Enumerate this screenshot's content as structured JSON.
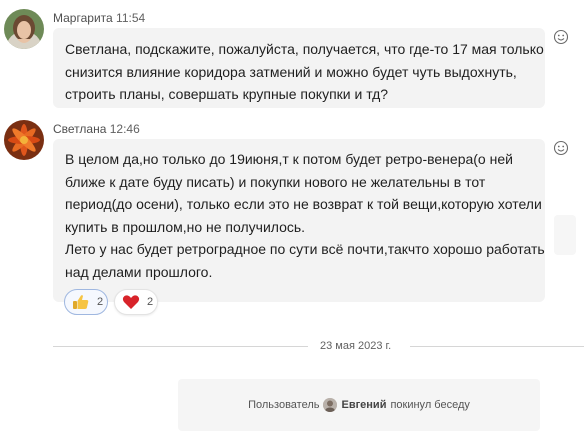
{
  "messages": [
    {
      "author": "Маргарита",
      "time": "11:54",
      "lines": [
        "Светлана, подскажите, пожалуйста, получается, что где-то 17 мая только",
        "снизится влияние коридора затмений и можно будет чуть выдохнуть,",
        "строить планы, совершать крупные покупки и тд?"
      ]
    },
    {
      "author": "Светлана",
      "time": "12:46",
      "lines": [
        "В целом да,но только до 19июня,т к потом будет ретро-венера(о ней",
        "ближе к дате буду писать) и покупки нового не желательны в тот",
        "период(до осени), только если это не возврат к той вещи,которую хотели",
        "купить в прошлом,но не получилось.",
        "Лето у нас будет ретроградное по сути всё почти,такчто хорошо работать",
        "над делами прошлого."
      ],
      "reactions": [
        {
          "icon": "thumbs-up-icon",
          "count": "2",
          "selected": true
        },
        {
          "icon": "heart-icon",
          "count": "2",
          "selected": false
        }
      ]
    }
  ],
  "date_divider": "23 мая 2023 г.",
  "system_message": {
    "prefix": "Пользователь",
    "user": "Евгений",
    "suffix": "покинул беседу"
  }
}
